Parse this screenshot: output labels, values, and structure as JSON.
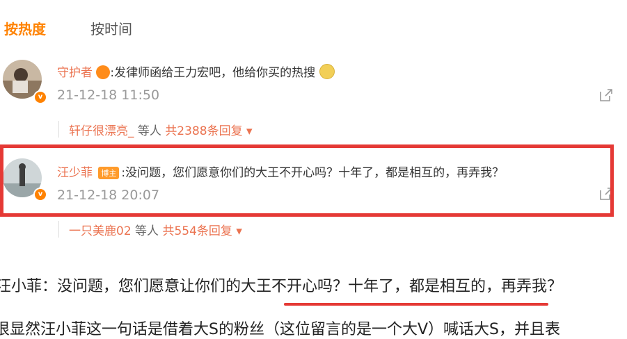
{
  "tabs": {
    "hot": "按热度",
    "time": "按时间"
  },
  "comments": [
    {
      "user": "守护者",
      "text": ":发律师函给王力宏吧，他给你买的热搜",
      "time": "21-12-18 11:50",
      "reply": {
        "user": "轩仔很漂亮_",
        "mid": " 等人 ",
        "count": "共2388条回复",
        "arrow": "▾"
      }
    },
    {
      "user": "汪少菲",
      "badge": "博主",
      "text": ":没问题，您们愿意你们的大王不开心吗？十年了，都是相互的，再弄我？",
      "time": "21-12-18 20:07",
      "reply": {
        "user": "一只美鹿02",
        "mid": " 等人 ",
        "count": "共554条回复",
        "arrow": "▾"
      }
    }
  ],
  "article": {
    "line1": "汪小菲：没问题，您们愿意让你们的大王不开心吗？十年了，都是相互的，再弄我？",
    "line2": "很显然汪小菲这一句话是借着大S的粉丝（这位留言的是一个大V）喊话大S，并且表"
  },
  "colors": {
    "accent": "#ff8200",
    "username": "#eb7350",
    "highlight": "#e53935"
  },
  "icons": [
    "share-icon",
    "verified-icon",
    "dropdown-arrow-icon",
    "emoji-icon"
  ]
}
